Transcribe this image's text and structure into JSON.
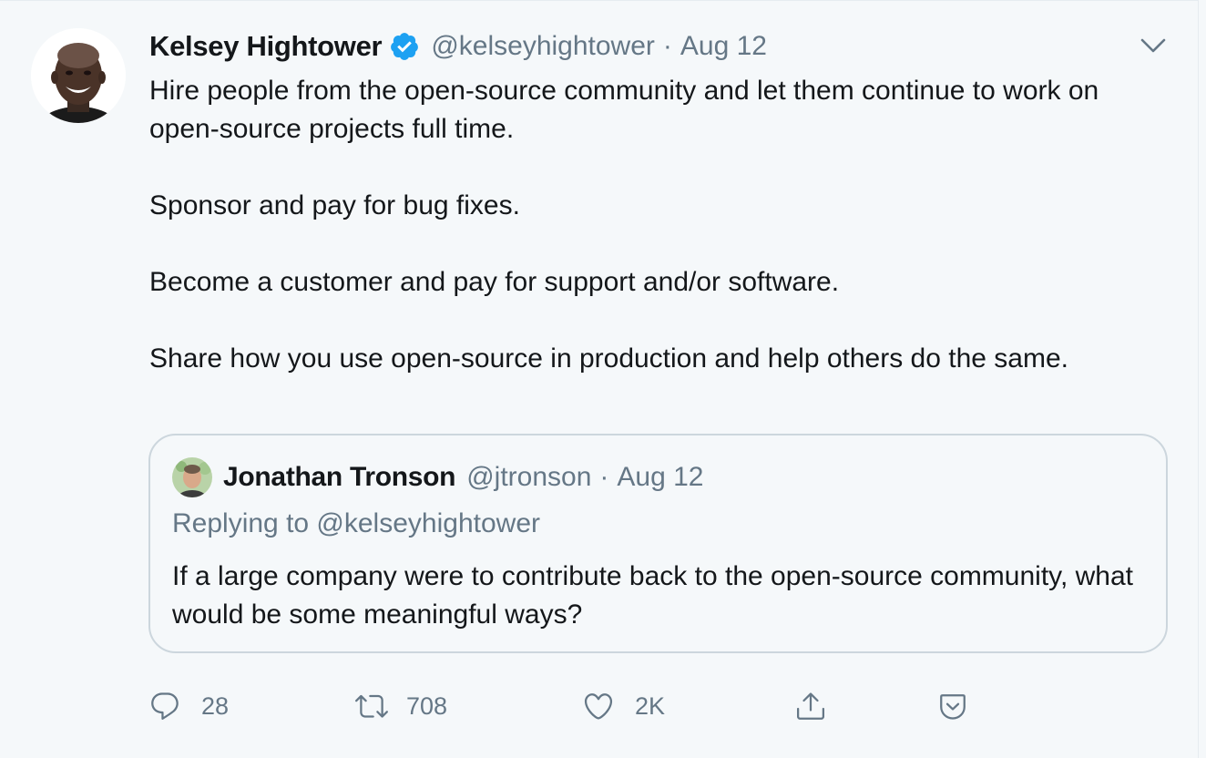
{
  "tweet": {
    "author_name": "Kelsey Hightower",
    "author_handle": "@kelseyhightower",
    "separator": "·",
    "date": "Aug 12",
    "verified": true,
    "paragraphs": [
      "Hire people from the open-source community and let them continue to work on open-source projects full time.",
      "Sponsor and pay for bug fixes.",
      "Become a customer and pay for support and/or software.",
      "Share how you use open-source in production and help others do the same."
    ]
  },
  "quoted_tweet": {
    "author_name": "Jonathan Tronson",
    "author_handle": "@jtronson",
    "separator": "·",
    "date": "Aug 12",
    "replying_to": "Replying to @kelseyhightower",
    "text": "If a large company were to contribute back to the open-source community, what would be some meaningful ways?"
  },
  "actions": {
    "reply": {
      "icon": "reply-icon",
      "count": "28"
    },
    "retweet": {
      "icon": "retweet-icon",
      "count": "708"
    },
    "like": {
      "icon": "heart-icon",
      "count": "2K"
    },
    "share": {
      "icon": "share-icon"
    },
    "bookmark": {
      "icon": "bookmark-icon"
    }
  },
  "colors": {
    "background": "#f5f8fa",
    "primary_text": "#14171a",
    "secondary_text": "#657786",
    "verified_blue": "#1da1f2",
    "border": "#ccd6dd"
  }
}
